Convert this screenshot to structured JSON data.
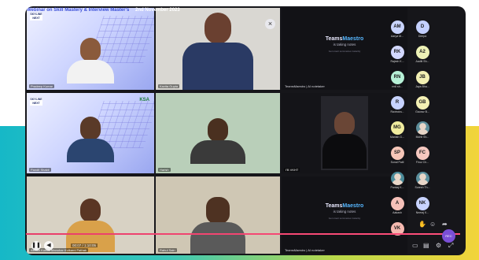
{
  "meeting": {
    "banner_title": "Webinar on Skill Mastery & Interview Master's",
    "banner_date": "2nd November 2023"
  },
  "tiles": {
    "host_name": "Pradeep Kumar",
    "second_name": "Kavita Gupta",
    "third_name": "Pandit Shakti",
    "fourth_name": "Harish",
    "fifth_name": "I'B VKHT",
    "sixth_name": "Ashish Kumar Manohar Kulkarni Pathak",
    "seventh_name": "Rahul Sain",
    "maestro_name": "TeamsMaestro",
    "maestro_label_1": "TeamsMaestro | AI notetaker",
    "maestro_label_2": "TeamsMaestro | AI notetaker",
    "brand_prefix": "Teams",
    "brand_suffix": "Maestro",
    "brand_status": "is taking notes",
    "brand_small": "Get smart summaries instantly",
    "logo_left": "SKYLINE NEXT",
    "logo_right": "KSA"
  },
  "participants": [
    {
      "initials": "AM",
      "name": "Aarya M...",
      "color": "#c9d4ff"
    },
    {
      "initials": "D",
      "name": "Deepa",
      "color": "#c4d0ff"
    },
    {
      "initials": "RK",
      "name": "Rajesh K...",
      "color": "#d3d8ff"
    },
    {
      "initials": "A2",
      "name": "Aaditi Sh...",
      "color": "#eef2b6"
    },
    {
      "initials": "RN",
      "name": "rmil sh...",
      "color": "#b6f0d6"
    },
    {
      "initials": "JB",
      "name": "Jaya Bha...",
      "color": "#f2efb3"
    },
    {
      "initials": "R",
      "name": "Ravindra...",
      "color": "#c7d3ff"
    },
    {
      "initials": "GB",
      "name": "Gaurav B...",
      "color": "#f4f0b4"
    },
    {
      "initials": "MG",
      "name": "Manish G...",
      "color": "#f0ec9e"
    },
    {
      "initials": "",
      "name": "Mohit Sh...",
      "color": "#5c8d9a"
    },
    {
      "initials": "SP",
      "name": "Sonal Patil",
      "color": "#f6c6b8"
    },
    {
      "initials": "FC",
      "name": "Firoz Ch...",
      "color": "#f6c8c0"
    },
    {
      "initials": "",
      "name": "Pankaj K...",
      "color": "#4b8b9a"
    },
    {
      "initials": "",
      "name": "Suresh Th...",
      "color": "#5a8f9d"
    },
    {
      "initials": "A",
      "name": "Aakash",
      "color": "#f5c0b8"
    },
    {
      "initials": "NK",
      "name": "Neeraj K...",
      "color": "#c8d3ff"
    },
    {
      "initials": "VK",
      "name": "",
      "color": "#f5b9b0"
    }
  ],
  "controls": {
    "time": "00:07 / 1:10:05",
    "record_label": "REC",
    "colors": {
      "seek": "#e83e6a",
      "record": "#7a4fd6"
    }
  }
}
